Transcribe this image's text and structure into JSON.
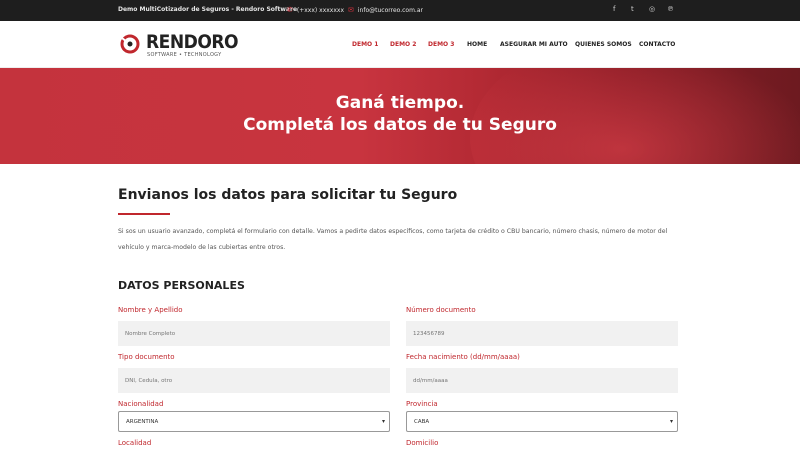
{
  "topbar": {
    "tagline": "Demo MultiCotizador de Seguros - Rendoro Software",
    "phone": "(+xxx) xxxxxxx",
    "email": "info@tucorreo.com.ar",
    "social": [
      "facebook",
      "twitter",
      "instagram",
      "pinterest"
    ]
  },
  "logo": {
    "name": "RENDORO",
    "sub": "SOFTWARE • TECHNOLOGY"
  },
  "nav": [
    "DEMO 1",
    "DEMO 2",
    "DEMO 3",
    "HOME",
    "ASEGURAR MI AUTO",
    "QUIENES SOMOS",
    "CONTACTO"
  ],
  "hero": {
    "line1": "Ganá tiempo.",
    "line2": "Completá los datos de tu Seguro"
  },
  "main": {
    "title": "Envianos los datos para solicitar tu Seguro",
    "intro": "Si sos un usuario avanzado, completá el formulario con detalle. Vamos a pedirte datos específicos, como tarjeta de crédito o CBU bancario, número chasis, número de motor del vehículo y marca-modelo de las cubiertas entre otros.",
    "section": "DATOS PERSONALES"
  },
  "form": {
    "nombre": {
      "label": "Nombre y Apellido",
      "placeholder": "Nombre Completo"
    },
    "documento": {
      "label": "Número documento",
      "placeholder": "123456789"
    },
    "tipo": {
      "label": "Tipo documento",
      "placeholder": "DNI, Cedula, otro"
    },
    "nacimiento": {
      "label": "Fecha nacimiento (dd/mm/aaaa)",
      "placeholder": "dd/mm/aaaa"
    },
    "nacionalidad": {
      "label": "Nacionalidad",
      "value": "ARGENTINA"
    },
    "provincia": {
      "label": "Provincia",
      "value": "CABA"
    },
    "localidad": {
      "label": "Localidad"
    },
    "domicilio": {
      "label": "Domicilio"
    }
  },
  "colors": {
    "accent": "#c0272d",
    "topbar": "#1e1e1e"
  }
}
